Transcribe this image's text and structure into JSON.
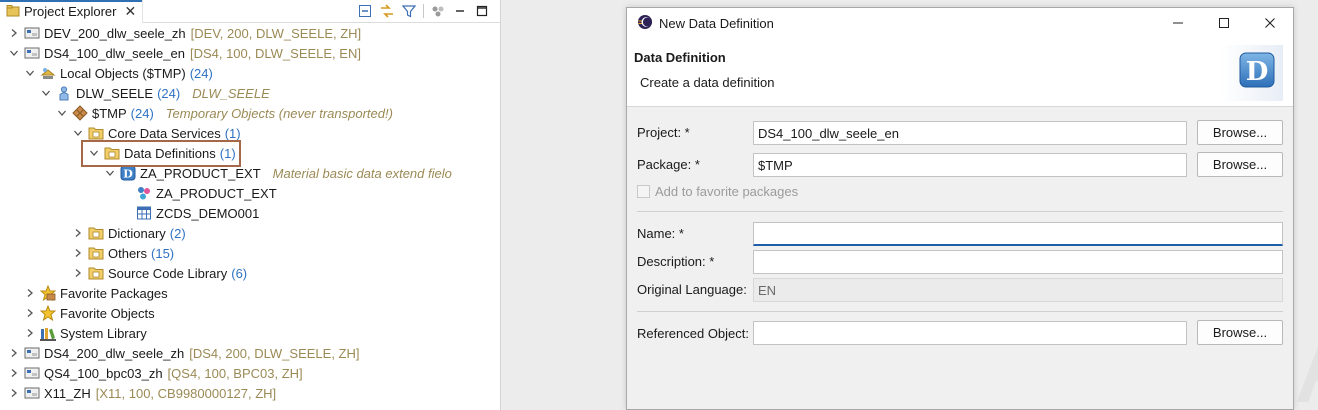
{
  "explorer": {
    "tab_title": "Project Explorer",
    "rows": [
      {
        "label": "DEV_200_dlw_seele_zh",
        "dec": "[DEV, 200, DLW_SEELE, ZH]",
        "cnt": "",
        "ital": "",
        "icon": "project-icon"
      },
      {
        "label": "DS4_100_dlw_seele_en",
        "dec": "[DS4, 100, DLW_SEELE, EN]",
        "cnt": "",
        "ital": "",
        "icon": "project-icon"
      },
      {
        "label": "Local Objects ($TMP)",
        "dec": "",
        "cnt": "(24)",
        "ital": "",
        "icon": "local-objects-icon"
      },
      {
        "label": "DLW_SEELE",
        "dec": "",
        "cnt": "(24)",
        "ital": "DLW_SEELE",
        "icon": "user-icon"
      },
      {
        "label": "$TMP",
        "dec": "",
        "cnt": "(24)",
        "ital": "Temporary Objects (never transported!)",
        "icon": "package-icon"
      },
      {
        "label": "Core Data Services",
        "dec": "",
        "cnt": "(1)",
        "ital": "",
        "icon": "folder-icon"
      },
      {
        "label": "Data Definitions",
        "dec": "",
        "cnt": "(1)",
        "ital": "",
        "icon": "folder-icon"
      },
      {
        "label": "ZA_PRODUCT_EXT",
        "dec": "",
        "cnt": "",
        "ital": "Material basic data extend fielo",
        "icon": "ddl-icon"
      },
      {
        "label": "ZA_PRODUCT_EXT",
        "dec": "",
        "cnt": "",
        "ital": "",
        "icon": "cds-entity-icon"
      },
      {
        "label": "ZCDS_DEMO001",
        "dec": "",
        "cnt": "",
        "ital": "",
        "icon": "table-icon"
      },
      {
        "label": "Dictionary",
        "dec": "",
        "cnt": "(2)",
        "ital": "",
        "icon": "folder-icon"
      },
      {
        "label": "Others",
        "dec": "",
        "cnt": "(15)",
        "ital": "",
        "icon": "folder-icon"
      },
      {
        "label": "Source Code Library",
        "dec": "",
        "cnt": "(6)",
        "ital": "",
        "icon": "folder-icon"
      },
      {
        "label": "Favorite Packages",
        "dec": "",
        "cnt": "",
        "ital": "",
        "icon": "favorite-packages-icon"
      },
      {
        "label": "Favorite Objects",
        "dec": "",
        "cnt": "",
        "ital": "",
        "icon": "star-icon"
      },
      {
        "label": "System Library",
        "dec": "",
        "cnt": "",
        "ital": "",
        "icon": "library-icon"
      },
      {
        "label": "DS4_200_dlw_seele_zh",
        "dec": "[DS4, 200, DLW_SEELE, ZH]",
        "cnt": "",
        "ital": "",
        "icon": "project-icon"
      },
      {
        "label": "QS4_100_bpc03_zh",
        "dec": "[QS4, 100, BPC03, ZH]",
        "cnt": "",
        "ital": "",
        "icon": "project-icon"
      },
      {
        "label": "X11_ZH",
        "dec": "[X11, 100, CB9980000127, ZH]",
        "cnt": "",
        "ital": "",
        "icon": "project-icon"
      }
    ]
  },
  "dialog": {
    "title": "New Data Definition",
    "banner_title": "Data Definition",
    "banner_subtitle": "Create a data definition",
    "logo_letter": "D",
    "project_label": "Project: *",
    "project_value": "DS4_100_dlw_seele_en",
    "package_label": "Package: *",
    "package_value": "$TMP",
    "browse_label": "Browse...",
    "favorite_label": "Add to favorite packages",
    "name_label": "Name: *",
    "name_value": "",
    "description_label": "Description: *",
    "description_value": "",
    "original_language_label": "Original Language:",
    "original_language_value": "EN",
    "referenced_object_label": "Referenced Object:",
    "referenced_object_value": ""
  },
  "colors": {
    "accent": "#2f6fb3",
    "highlight_box": "#a5694a",
    "decoration": "#9b8a55",
    "count": "#2f72c4"
  }
}
